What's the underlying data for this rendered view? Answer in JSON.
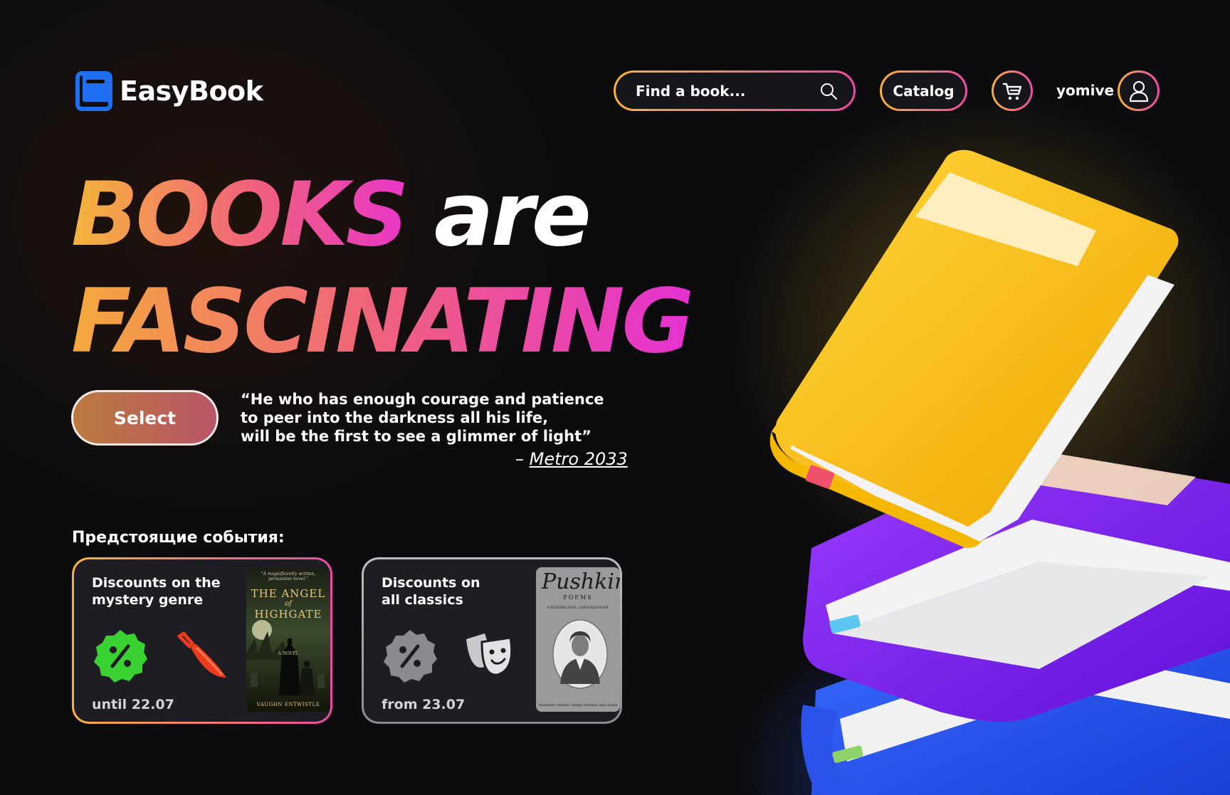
{
  "header": {
    "logo_text": "EasyBook",
    "search_placeholder": "Find a book...",
    "catalog_label": "Catalog",
    "username": "yomive"
  },
  "hero": {
    "line1_word1": "BOOKS",
    "line1_word2": "are",
    "line2": "FASCINATING",
    "select_label": "Select",
    "quote_line1": "“He who has enough courage and patience",
    "quote_line2": "to peer into the darkness all his life,",
    "quote_line3": "will be the first to see a glimmer of light”",
    "quote_dash": "– ",
    "quote_source": "Metro 2033"
  },
  "events": {
    "title": "Предстоящие события:",
    "cards": [
      {
        "title_line1": "Discounts on the",
        "title_line2": "mystery genre",
        "date": "until 22.07",
        "badge_icon": "percent-badge-icon",
        "genre_icon": "knife-icon",
        "badge_color": "#39d232",
        "genre_color": "#ef3b1d",
        "cover": {
          "blurb": "\"A magnificently written, persuasive novel.\"",
          "title_line1": "THE ANGEL",
          "title_line2": "of",
          "title_line3": "HIGHGATE",
          "subtitle": "A NOVEL",
          "author": "VAUGHN ENTWISTLE"
        }
      },
      {
        "title_line1": "Discounts on",
        "title_line2": "all classics",
        "date": "from 23.07",
        "badge_icon": "percent-badge-icon",
        "genre_icon": "theater-masks-icon",
        "badge_color": "#8a8a90",
        "genre_color": "#c9c9cc",
        "cover": {
          "title": "Pushkin",
          "subtitle": "POEMS",
          "tagline": "A RUSSIAN DUAL LANGUAGE BOOK",
          "authors": "Alexander Pushkin, Sergey Moszkiy, Sasa Hazzu"
        }
      }
    ]
  },
  "colors": {
    "accent_orange": "#f6b23b",
    "accent_pink": "#ee4aa6",
    "logo_blue": "#1f6ff2",
    "book_yellow": "#f4c012",
    "book_purple": "#7c1ff0",
    "book_blue": "#2457ef"
  }
}
